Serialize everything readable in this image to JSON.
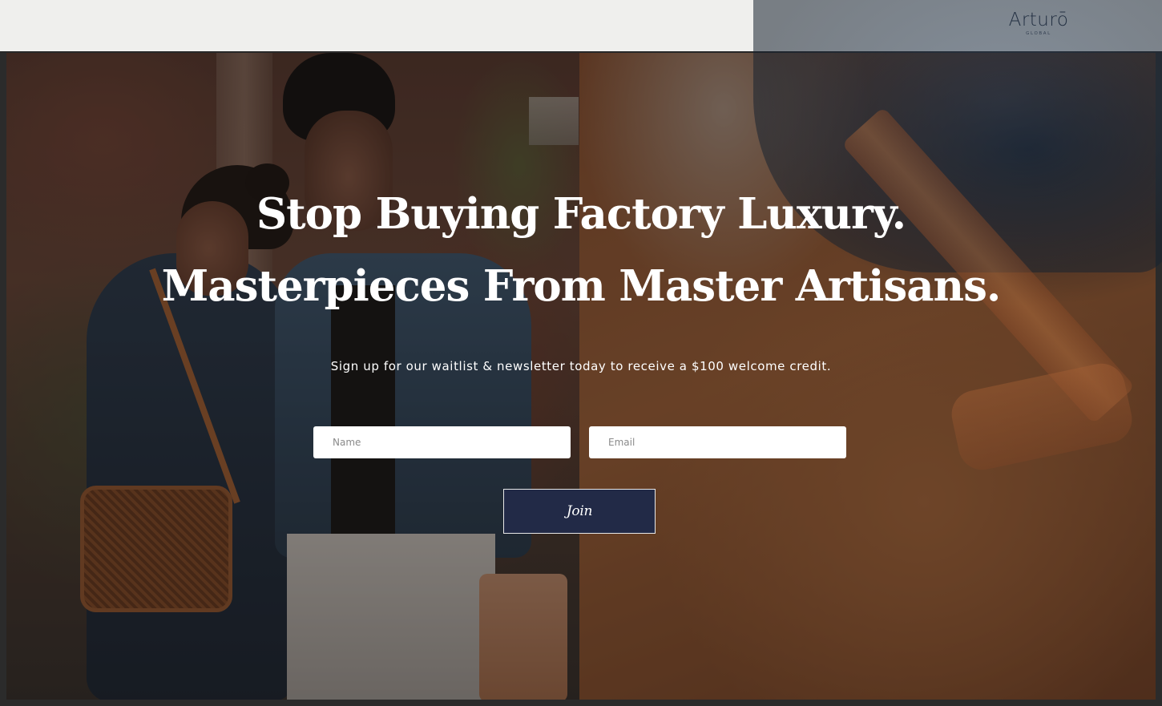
{
  "brand": {
    "name": "Arturō",
    "sub": "GLOBAL"
  },
  "hero": {
    "headline_line1": "Stop Buying Factory Luxury.",
    "headline_line2": "Masterpieces From Master Artisans.",
    "subtitle": "Sign up for our waitlist & newsletter today to receive a $100 welcome credit."
  },
  "form": {
    "name_placeholder": "Name",
    "name_value": "",
    "email_placeholder": "Email",
    "email_value": "",
    "submit_label": "Join"
  },
  "colors": {
    "topbar": "#efefed",
    "logo": "#263043",
    "button": "#222a47",
    "text_on_hero": "#ffffff"
  }
}
